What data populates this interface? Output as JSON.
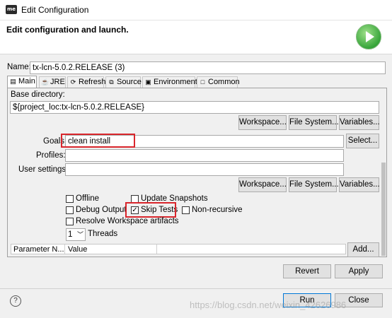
{
  "window": {
    "title": "Edit Configuration",
    "app_icon": "eclipse-mars-icon"
  },
  "header": {
    "title": "Edit configuration and launch.",
    "run_icon": "run-play-icon"
  },
  "name": {
    "label": "Name:",
    "value": "tx-lcn-5.0.2.RELEASE (3)"
  },
  "tabs": [
    {
      "label": "Main",
      "icon": "document-icon"
    },
    {
      "label": "JRE",
      "icon": "jre-icon"
    },
    {
      "label": "Refresh",
      "icon": "refresh-icon"
    },
    {
      "label": "Source",
      "icon": "source-icon"
    },
    {
      "label": "Environment",
      "icon": "environment-icon"
    },
    {
      "label": "Common",
      "icon": "common-icon"
    }
  ],
  "main": {
    "base_directory": {
      "label": "Base directory:",
      "value": "${project_loc:tx-lcn-5.0.2.RELEASE}"
    },
    "buttons": {
      "workspace": "Workspace...",
      "file_system": "File System...",
      "variables": "Variables...",
      "select": "Select..."
    },
    "goals": {
      "label": "Goals:",
      "value": "clean install"
    },
    "profiles": {
      "label": "Profiles:",
      "value": ""
    },
    "user_settings": {
      "label": "User settings:",
      "value": ""
    },
    "checkboxes": {
      "offline": {
        "label": "Offline",
        "checked": false
      },
      "update_snapshots": {
        "label": "Update Snapshots",
        "checked": false
      },
      "debug_output": {
        "label": "Debug Output",
        "checked": false
      },
      "skip_tests": {
        "label": "Skip Tests",
        "checked": true
      },
      "non_recursive": {
        "label": "Non-recursive",
        "checked": false
      },
      "resolve_workspace": {
        "label": "Resolve Workspace artifacts",
        "checked": false
      }
    },
    "threads": {
      "value": "1",
      "label": "Threads"
    },
    "parameter_table": {
      "columns": [
        "Parameter N...",
        "Value"
      ],
      "add_button": "Add..."
    }
  },
  "footer": {
    "revert": "Revert",
    "apply": "Apply",
    "run": "Run",
    "close": "Close",
    "watermark": "https://blog.csdn.net/weixin_42626986"
  },
  "colors": {
    "highlight_box": "#d9262c",
    "dialog_bg": "#f0f0f0"
  }
}
